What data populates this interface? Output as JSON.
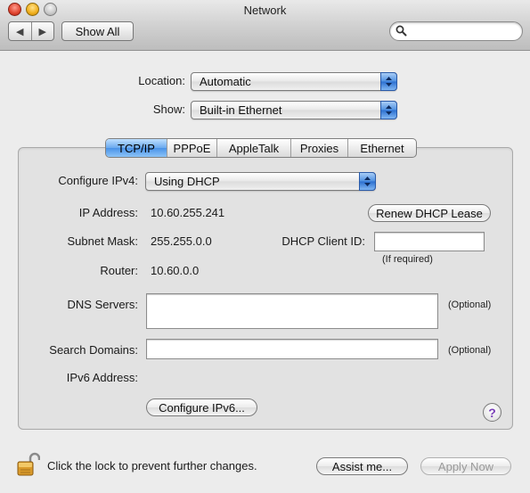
{
  "window": {
    "title": "Network"
  },
  "toolbar": {
    "show_all_label": "Show All",
    "back_glyph": "◀",
    "forward_glyph": "▶",
    "search_icon": "search-icon"
  },
  "location": {
    "label": "Location:",
    "value": "Automatic"
  },
  "show": {
    "label": "Show:",
    "value": "Built-in Ethernet"
  },
  "tabs": [
    {
      "label": "TCP/IP",
      "active": true
    },
    {
      "label": "PPPoE",
      "active": false
    },
    {
      "label": "AppleTalk",
      "active": false
    },
    {
      "label": "Proxies",
      "active": false
    },
    {
      "label": "Ethernet",
      "active": false
    }
  ],
  "tcpip": {
    "configure_label": "Configure IPv4:",
    "configure_value": "Using DHCP",
    "ip_label": "IP Address:",
    "ip_value": "10.60.255.241",
    "renew_label": "Renew DHCP Lease",
    "subnet_label": "Subnet Mask:",
    "subnet_value": "255.255.0.0",
    "dhcp_client_label": "DHCP Client ID:",
    "dhcp_client_value": "",
    "if_required": "(If required)",
    "router_label": "Router:",
    "router_value": "10.60.0.0",
    "dns_label": "DNS Servers:",
    "dns_value": "",
    "dns_optional": "(Optional)",
    "search_domains_label": "Search Domains:",
    "search_domains_value": "",
    "search_optional": "(Optional)",
    "ipv6_label": "IPv6 Address:",
    "configure_ipv6_label": "Configure IPv6..."
  },
  "help": {
    "glyph": "?"
  },
  "footer": {
    "lock_text": "Click the lock to prevent further changes.",
    "assist_label": "Assist me...",
    "apply_label": "Apply Now"
  },
  "colors": {
    "accent": "#4a92e8",
    "window_bg": "#ececec",
    "help_glyph": "#7a3fb8"
  }
}
